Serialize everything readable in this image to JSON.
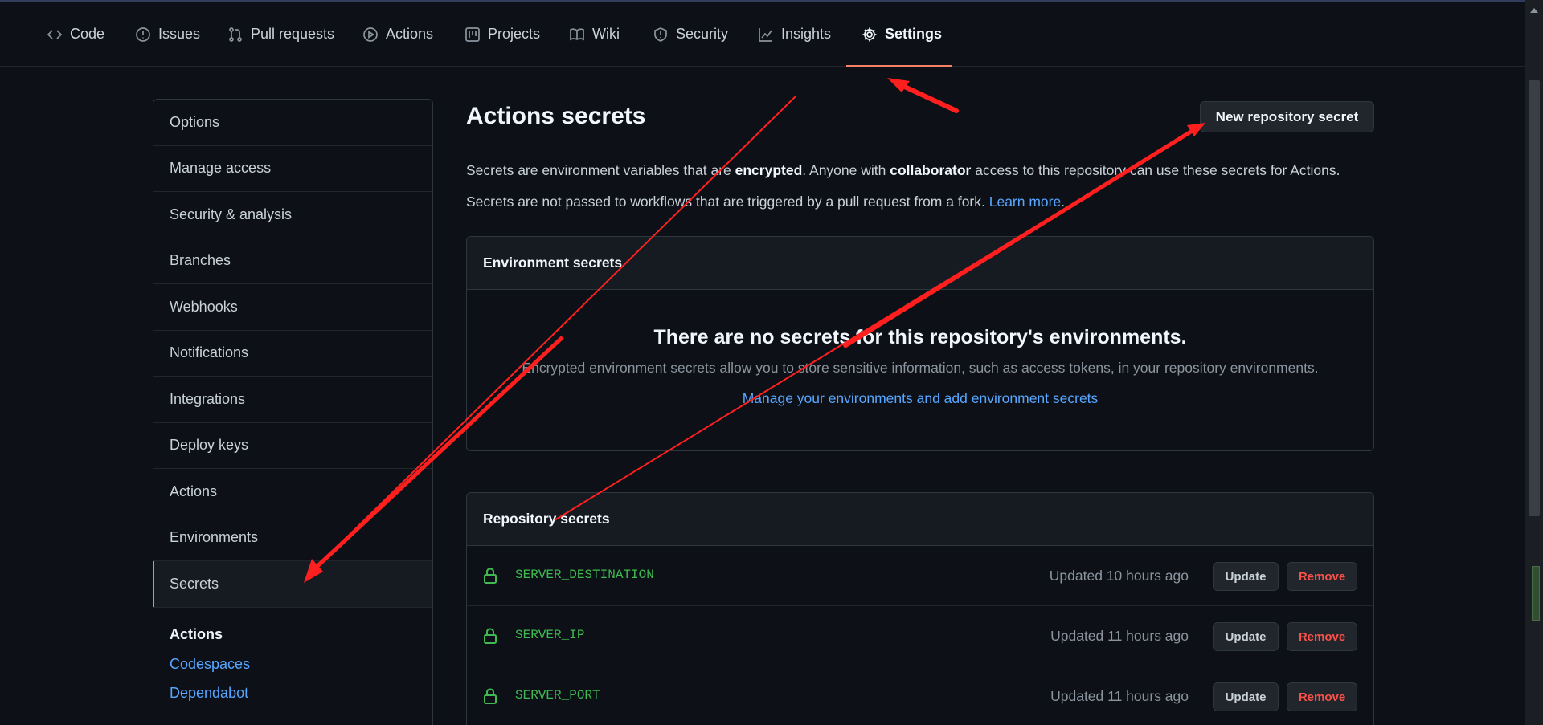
{
  "tabs": [
    {
      "label": "Code",
      "icon": "code-icon"
    },
    {
      "label": "Issues",
      "icon": "issue-icon"
    },
    {
      "label": "Pull requests",
      "icon": "pull-request-icon"
    },
    {
      "label": "Actions",
      "icon": "play-icon"
    },
    {
      "label": "Projects",
      "icon": "project-icon"
    },
    {
      "label": "Wiki",
      "icon": "book-icon"
    },
    {
      "label": "Security",
      "icon": "shield-icon"
    },
    {
      "label": "Insights",
      "icon": "graph-icon"
    },
    {
      "label": "Settings",
      "icon": "gear-icon",
      "active": true
    }
  ],
  "sidebar": {
    "items": [
      "Options",
      "Manage access",
      "Security & analysis",
      "Branches",
      "Webhooks",
      "Notifications",
      "Integrations",
      "Deploy keys",
      "Actions",
      "Environments",
      "Secrets"
    ],
    "selected": "Secrets",
    "sub_heading": "Actions",
    "sub_links": [
      "Codespaces",
      "Dependabot"
    ]
  },
  "main": {
    "title": "Actions secrets",
    "new_button": "New repository secret",
    "desc1": {
      "t1": "Secrets are environment variables that are ",
      "b1": "encrypted",
      "t2": ". Anyone with ",
      "b2": "collaborator",
      "t3": " access to this repository can use these secrets for Actions."
    },
    "desc2": {
      "text": "Secrets are not passed to workflows that are triggered by a pull request from a fork. ",
      "link": "Learn more",
      "end": "."
    },
    "environment_secrets": {
      "heading": "Environment secrets",
      "blank_title": "There are no secrets for this repository's environments.",
      "blank_desc": "Encrypted environment secrets allow you to store sensitive information, such as access tokens, in your repository environments.",
      "blank_link": "Manage your environments and add environment secrets"
    },
    "repository_secrets": {
      "heading": "Repository secrets",
      "update_label": "Update",
      "remove_label": "Remove",
      "rows": [
        {
          "name": "SERVER_DESTINATION",
          "updated": "Updated 10 hours ago"
        },
        {
          "name": "SERVER_IP",
          "updated": "Updated 11 hours ago"
        },
        {
          "name": "SERVER_PORT",
          "updated": "Updated 11 hours ago"
        }
      ]
    }
  },
  "colors": {
    "background": "#0d1117",
    "accent": "#f78166",
    "link": "#58a6ff",
    "secret_name": "#3fb950",
    "danger": "#f85149",
    "annotation_arrow": "#ff1f1f"
  }
}
